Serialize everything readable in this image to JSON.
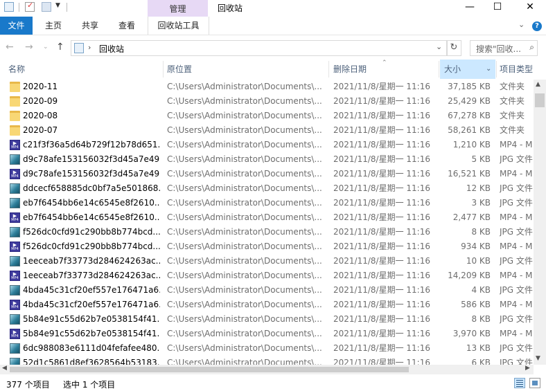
{
  "window": {
    "title": "回收站",
    "context_tab_group": "管理"
  },
  "ribbon": {
    "tabs": [
      {
        "label": "文件"
      },
      {
        "label": "主页"
      },
      {
        "label": "共享"
      },
      {
        "label": "查看"
      },
      {
        "label": "回收站工具"
      }
    ]
  },
  "address": {
    "path": "回收站",
    "search_placeholder": "搜索\"回收..."
  },
  "columns": [
    {
      "label": "名称"
    },
    {
      "label": "原位置"
    },
    {
      "label": "删除日期"
    },
    {
      "label": "大小"
    },
    {
      "label": "项目类型"
    }
  ],
  "files": [
    {
      "icon": "folder-icon",
      "name": "2020-11",
      "location": "C:\\Users\\Administrator\\Documents\\...",
      "date": "2021/11/8/星期一 11:16",
      "size": "37,185 KB",
      "type": "文件夹"
    },
    {
      "icon": "folder-icon",
      "name": "2020-09",
      "location": "C:\\Users\\Administrator\\Documents\\...",
      "date": "2021/11/8/星期一 11:16",
      "size": "25,429 KB",
      "type": "文件夹"
    },
    {
      "icon": "folder-icon",
      "name": "2020-08",
      "location": "C:\\Users\\Administrator\\Documents\\...",
      "date": "2021/11/8/星期一 11:16",
      "size": "67,278 KB",
      "type": "文件夹"
    },
    {
      "icon": "folder-icon",
      "name": "2020-07",
      "location": "C:\\Users\\Administrator\\Documents\\...",
      "date": "2021/11/8/星期一 11:16",
      "size": "58,261 KB",
      "type": "文件夹"
    },
    {
      "icon": "mp4-icon",
      "name": "c21f3f36a5d64b729f12b78d651...",
      "location": "C:\\Users\\Administrator\\Documents\\...",
      "date": "2021/11/8/星期一 11:16",
      "size": "1,210 KB",
      "type": "MP4 - M"
    },
    {
      "icon": "jpg-icon",
      "name": "d9c78afe153156032f3d45a7e49...",
      "location": "C:\\Users\\Administrator\\Documents\\...",
      "date": "2021/11/8/星期一 11:16",
      "size": "5 KB",
      "type": "JPG 文件"
    },
    {
      "icon": "mp4-icon",
      "name": "d9c78afe153156032f3d45a7e49...",
      "location": "C:\\Users\\Administrator\\Documents\\...",
      "date": "2021/11/8/星期一 11:16",
      "size": "16,521 KB",
      "type": "MP4 - M"
    },
    {
      "icon": "jpg-icon",
      "name": "ddcecf658885dc0bf7a5e501868...",
      "location": "C:\\Users\\Administrator\\Documents\\...",
      "date": "2021/11/8/星期一 11:16",
      "size": "12 KB",
      "type": "JPG 文件"
    },
    {
      "icon": "jpg-icon",
      "name": "eb7f6454bb6e14c6545e8f2610...",
      "location": "C:\\Users\\Administrator\\Documents\\...",
      "date": "2021/11/8/星期一 11:16",
      "size": "3 KB",
      "type": "JPG 文件"
    },
    {
      "icon": "mp4-icon",
      "name": "eb7f6454bb6e14c6545e8f2610...",
      "location": "C:\\Users\\Administrator\\Documents\\...",
      "date": "2021/11/8/星期一 11:16",
      "size": "2,477 KB",
      "type": "MP4 - M"
    },
    {
      "icon": "jpg-icon",
      "name": "f526dc0cfd91c290bb8b774bcd...",
      "location": "C:\\Users\\Administrator\\Documents\\...",
      "date": "2021/11/8/星期一 11:16",
      "size": "8 KB",
      "type": "JPG 文件"
    },
    {
      "icon": "mp4-icon",
      "name": "f526dc0cfd91c290bb8b774bcd...",
      "location": "C:\\Users\\Administrator\\Documents\\...",
      "date": "2021/11/8/星期一 11:16",
      "size": "934 KB",
      "type": "MP4 - M"
    },
    {
      "icon": "jpg-icon",
      "name": "1eeceab7f33773d284624263ac...",
      "location": "C:\\Users\\Administrator\\Documents\\...",
      "date": "2021/11/8/星期一 11:16",
      "size": "10 KB",
      "type": "JPG 文件"
    },
    {
      "icon": "mp4-icon",
      "name": "1eeceab7f33773d284624263ac...",
      "location": "C:\\Users\\Administrator\\Documents\\...",
      "date": "2021/11/8/星期一 11:16",
      "size": "14,209 KB",
      "type": "MP4 - M"
    },
    {
      "icon": "jpg-icon",
      "name": "4bda45c31cf20ef557e176471a6...",
      "location": "C:\\Users\\Administrator\\Documents\\...",
      "date": "2021/11/8/星期一 11:16",
      "size": "4 KB",
      "type": "JPG 文件"
    },
    {
      "icon": "mp4-icon",
      "name": "4bda45c31cf20ef557e176471a6...",
      "location": "C:\\Users\\Administrator\\Documents\\...",
      "date": "2021/11/8/星期一 11:16",
      "size": "586 KB",
      "type": "MP4 - M"
    },
    {
      "icon": "jpg-icon",
      "name": "5b84e91c55d62b7e0538154f41...",
      "location": "C:\\Users\\Administrator\\Documents\\...",
      "date": "2021/11/8/星期一 11:16",
      "size": "8 KB",
      "type": "JPG 文件"
    },
    {
      "icon": "mp4-icon",
      "name": "5b84e91c55d62b7e0538154f41...",
      "location": "C:\\Users\\Administrator\\Documents\\...",
      "date": "2021/11/8/星期一 11:16",
      "size": "3,970 KB",
      "type": "MP4 - M"
    },
    {
      "icon": "jpg-icon",
      "name": "6dc988083e6111d04fefafee480...",
      "location": "C:\\Users\\Administrator\\Documents\\...",
      "date": "2021/11/8/星期一 11:16",
      "size": "13 KB",
      "type": "JPG 文件"
    },
    {
      "icon": "jpg-icon",
      "name": "52d1c5861d8ef3628564b53183...",
      "location": "C:\\Users\\Administrator\\Documents\\...",
      "date": "2021/11/8/星期一 11:16",
      "size": "6 KB",
      "type": "JPG 文件"
    }
  ],
  "status": {
    "item_count": "377 个项目",
    "selection": "选中 1 个项目"
  },
  "colors": {
    "file_tab": "#1979ca",
    "context_tab": "#e7d9f5",
    "sorted_column": "#cce8ff"
  }
}
